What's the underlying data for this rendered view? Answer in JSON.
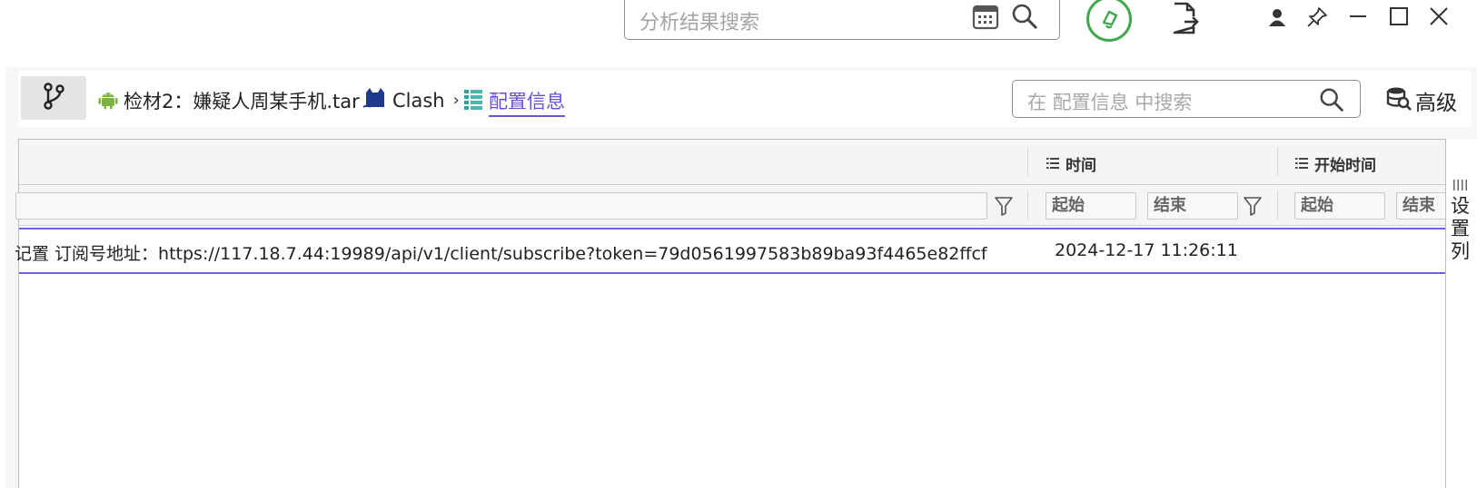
{
  "topbar": {
    "search_placeholder": "分析结果搜索",
    "icons": [
      "calendar-icon",
      "search-icon",
      "bell-icon",
      "export-icon",
      "user-icon",
      "pin-icon",
      "minimize-icon",
      "maximize-icon",
      "close-icon"
    ]
  },
  "breadcrumb": {
    "items": [
      {
        "label": "检材2：嫌疑人周某手机.tar",
        "icon": "android-icon"
      },
      {
        "label": "Clash",
        "icon": "cat-icon"
      },
      {
        "label": "配置信息",
        "icon": "list-icon"
      }
    ],
    "search_placeholder": "在 配置信息 中搜索",
    "advanced_label": "高级"
  },
  "table": {
    "columns": [
      {
        "label": ""
      },
      {
        "label": "时间"
      },
      {
        "label": "开始时间"
      }
    ],
    "filters": {
      "start": "起始",
      "end": "结束",
      "end_cut": "结束"
    },
    "rows": [
      {
        "content": "记置 订阅号地址：https://117.18.7.44:19989/api/v1/client/subscribe?token=79d0561997583b89ba93f4465e82ffcf",
        "time": "2024-12-17 11:26:11",
        "start_time": ""
      }
    ]
  },
  "settings_column": {
    "label": "设置列"
  },
  "colors": {
    "accent": "#6c63e0",
    "bell": "#3fa84e",
    "android": "#7cb342",
    "link": "#6a4fd6"
  }
}
